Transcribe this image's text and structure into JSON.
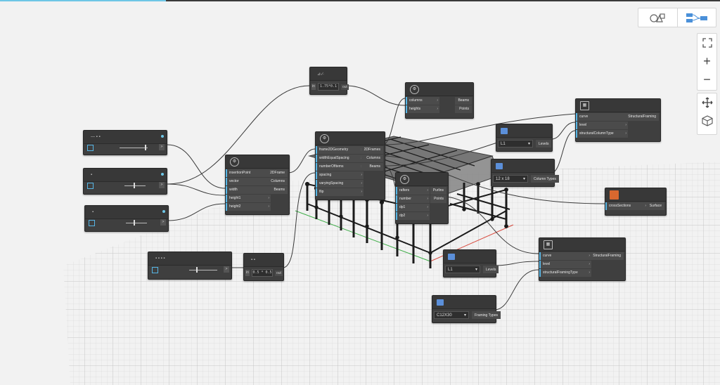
{
  "window": {
    "accent_color": "#6ec6e6",
    "canvas_bg": "#f2f2f2"
  },
  "toolbar": {
    "view_toggle": [
      {
        "name": "geometry-view",
        "icon": "shapes-icon",
        "active": false
      },
      {
        "name": "graph-view",
        "icon": "node-graph-icon",
        "active": true
      }
    ],
    "zoom_fit_icon": "fit-view-icon",
    "zoom_in_label": "+",
    "zoom_out_label": "−",
    "pan_icon": "pan-arrows-icon",
    "orbit_icon": "orbit-cube-icon"
  },
  "nodes": {
    "slider1": {
      "header": "— ▪ ▪",
      "value_port": ">"
    },
    "slider2": {
      "header": "▪",
      "value_port": ">"
    },
    "slider3": {
      "header": "▪",
      "value_port": ">"
    },
    "slider4": {
      "header": "▪ ▪ ▪ ▪",
      "value_port": ">"
    },
    "frame2d": {
      "inputs": [
        "insertionPoint",
        "vector",
        "width",
        "height1",
        "height2"
      ],
      "outputs": [
        "2DFrame",
        "Columns",
        "Beams"
      ]
    },
    "code_top": {
      "header": "⊿·∕·",
      "text": "1.75*0.1",
      "in": "in",
      "out": "out"
    },
    "code_mid": {
      "header": "▪ ▪",
      "text": "0.5 * 0.5",
      "in": "in",
      "out": "out"
    },
    "frame3d": {
      "inputs": [
        "frame2DGeometry",
        "widthEqualSpacing",
        "numberOfItems",
        "spacing",
        "varyingSpacing",
        "flip"
      ],
      "outputs": [
        "2DFrames",
        "Columns",
        "Beams"
      ]
    },
    "grid": {
      "inputs": [
        "columns",
        "heights"
      ],
      "outputs": [
        "Beams",
        "Points"
      ]
    },
    "purlins": {
      "inputs": [
        "rafters",
        "number",
        "dp1",
        "dp2"
      ],
      "outputs": [
        "Purlins",
        "Points"
      ]
    },
    "levels1": {
      "value": "L1",
      "output": "Levels"
    },
    "levels2": {
      "value": "L1",
      "output": "Levels"
    },
    "coltypes": {
      "value": "12 x 18",
      "output": "Column Types"
    },
    "framingtypes": {
      "value": "C12X30",
      "output": "Framing Types"
    },
    "sf_top": {
      "inputs": [
        "curve",
        "level",
        "structuralColumnType"
      ],
      "outputs": [
        "StructuralFraming"
      ]
    },
    "sf_bot": {
      "inputs": [
        "curve",
        "level",
        "structuralFramingType"
      ],
      "outputs": [
        "StructuralFraming"
      ]
    },
    "surface": {
      "inputs": [
        "crossSections"
      ],
      "outputs": [
        "Surface"
      ]
    }
  }
}
